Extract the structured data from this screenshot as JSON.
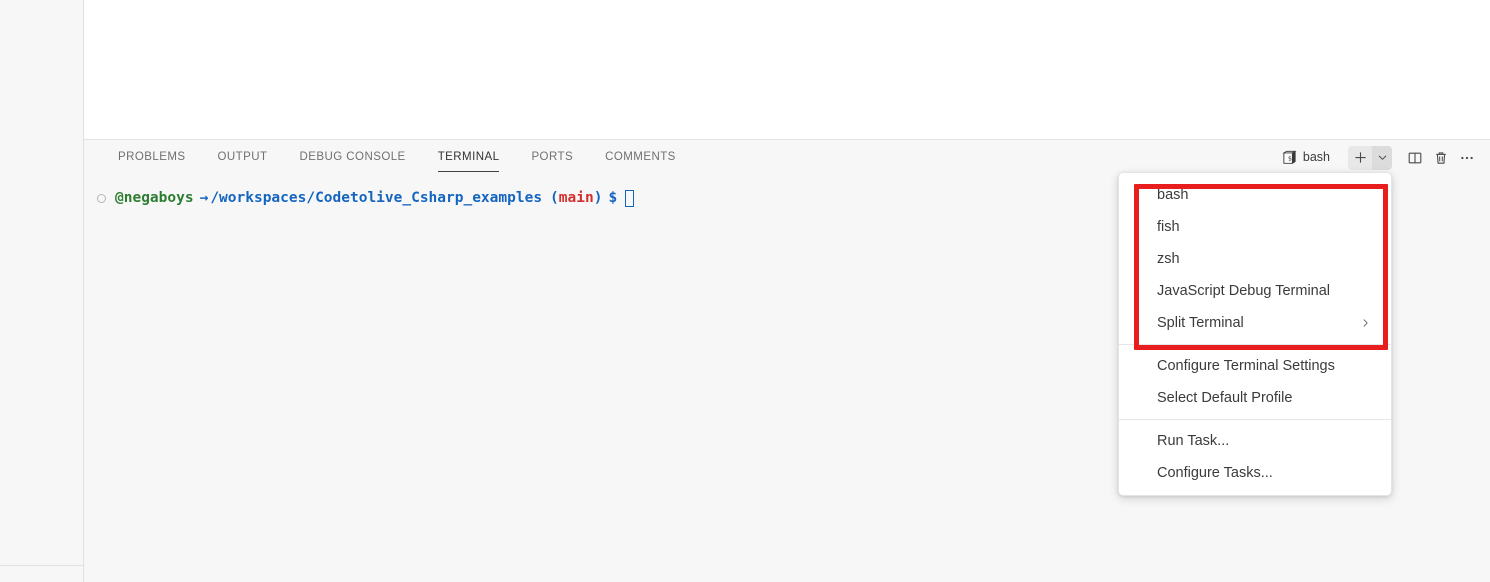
{
  "window": {
    "background_color": "#ffffff",
    "panel_background": "#f7f7f7",
    "accent_color": "#1565c0",
    "highlight_color": "#e81e1e"
  },
  "panel": {
    "tabs": [
      {
        "label": "PROBLEMS",
        "active": false
      },
      {
        "label": "OUTPUT",
        "active": false
      },
      {
        "label": "DEBUG CONSOLE",
        "active": false
      },
      {
        "label": "TERMINAL",
        "active": true
      },
      {
        "label": "PORTS",
        "active": false
      },
      {
        "label": "COMMENTS",
        "active": false
      }
    ],
    "actions": {
      "terminal_tab_label": "bash",
      "terminal_tab_icon": "terminal-bash-icon",
      "new_terminal_icon": "plus-icon",
      "new_terminal_dropdown_icon": "chevron-down-icon",
      "split_terminal_icon": "split-terminal-icon",
      "kill_terminal_icon": "trash-icon",
      "more_actions_icon": "ellipsis-icon"
    }
  },
  "terminal": {
    "decoration_icon": "command-decoration-circle-icon",
    "prompt": {
      "user": "@negaboys",
      "arrow": "→",
      "path": "/workspaces/Codetolive_Csharp_examples",
      "paren_open": "(",
      "branch": "main",
      "paren_close": ")",
      "dollar": "$"
    },
    "cursor": "block-cursor"
  },
  "context_menu": {
    "groups": [
      {
        "highlighted": true,
        "items": [
          {
            "label": "bash",
            "submenu": false
          },
          {
            "label": "fish",
            "submenu": false
          },
          {
            "label": "zsh",
            "submenu": false
          },
          {
            "label": "JavaScript Debug Terminal",
            "submenu": false
          },
          {
            "label": "Split Terminal",
            "submenu": true,
            "submenu_icon": "chevron-right-icon"
          }
        ]
      },
      {
        "highlighted": false,
        "items": [
          {
            "label": "Configure Terminal Settings",
            "submenu": false
          },
          {
            "label": "Select Default Profile",
            "submenu": false
          }
        ]
      },
      {
        "highlighted": false,
        "items": [
          {
            "label": "Run Task...",
            "submenu": false
          },
          {
            "label": "Configure Tasks...",
            "submenu": false
          }
        ]
      }
    ]
  }
}
